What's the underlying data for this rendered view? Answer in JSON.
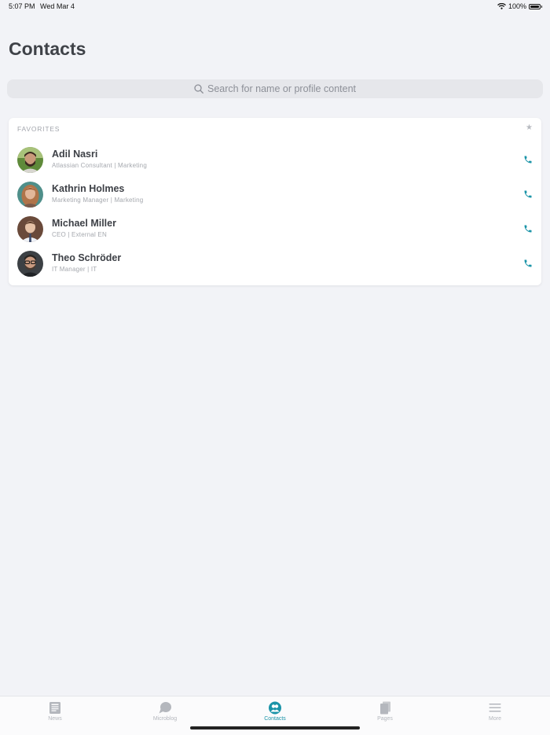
{
  "status": {
    "time": "5:07 PM",
    "date": "Wed Mar 4",
    "battery": "100%"
  },
  "page_title": "Contacts",
  "search": {
    "placeholder": "Search for name or profile content"
  },
  "favorites": {
    "header": "FAVORITES",
    "contacts": [
      {
        "name": "Adil Nasri",
        "subtitle": "Atlassian Consultant | Marketing"
      },
      {
        "name": "Kathrin Holmes",
        "subtitle": "Marketing Manager | Marketing"
      },
      {
        "name": "Michael Miller",
        "subtitle": "CEO | External EN"
      },
      {
        "name": "Theo Schröder",
        "subtitle": "IT Manager | IT"
      }
    ]
  },
  "tabs": [
    {
      "label": "News",
      "icon": "news-icon"
    },
    {
      "label": "Microblog",
      "icon": "chat-bubble-icon"
    },
    {
      "label": "Contacts",
      "icon": "contacts-icon",
      "active": true
    },
    {
      "label": "Pages",
      "icon": "pages-icon"
    },
    {
      "label": "More",
      "icon": "menu-icon"
    }
  ],
  "colors": {
    "accent": "#1b94a8",
    "background": "#f2f3f7"
  }
}
